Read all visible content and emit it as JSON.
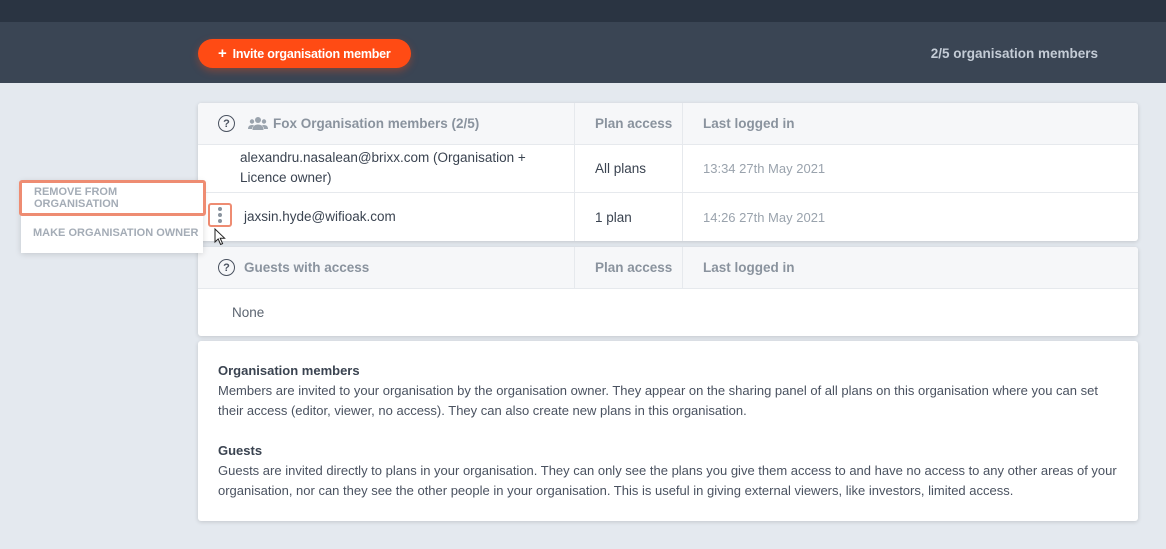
{
  "header": {
    "invite_label": "Invite organisation member",
    "member_count": "2/5 organisation members"
  },
  "members_table": {
    "title": "Fox Organisation members (2/5)",
    "col_plan_access": "Plan access",
    "col_last_logged": "Last logged in",
    "rows": [
      {
        "email": "alexandru.nasalean@brixx.com (Organisation + Licence owner)",
        "access": "All plans",
        "last_logged": "13:34 27th May 2021"
      },
      {
        "email": "jaxsin.hyde@wifioak.com",
        "access": "1 plan",
        "last_logged": "14:26 27th May 2021"
      }
    ]
  },
  "guests_table": {
    "title": "Guests with access",
    "col_plan_access": "Plan access",
    "col_last_logged": "Last logged in",
    "empty_text": "None"
  },
  "context_menu": {
    "remove": "REMOVE FROM ORGANISATION",
    "make_owner": "MAKE ORGANISATION OWNER"
  },
  "info": {
    "members_title": "Organisation members",
    "members_text": "Members are invited to your organisation by the organisation owner. They appear on the sharing panel of all plans on this organisation where you can set their access (editor, viewer, no access). They can also create new plans in this organisation.",
    "guests_title": "Guests",
    "guests_text": "Guests are invited directly to plans in your organisation. They can only see the plans you give them access to and have no access to any other areas of your organisation, nor can they see the other people in your organisation. This is useful in giving external viewers, like investors, limited access."
  },
  "icons": {
    "help": "help-circle-icon",
    "people": "people-icon",
    "kebab": "more-vertical-icon"
  },
  "colors": {
    "accent": "#ff4b14",
    "header_bg": "#3a4554",
    "highlight": "#ee8c72"
  }
}
